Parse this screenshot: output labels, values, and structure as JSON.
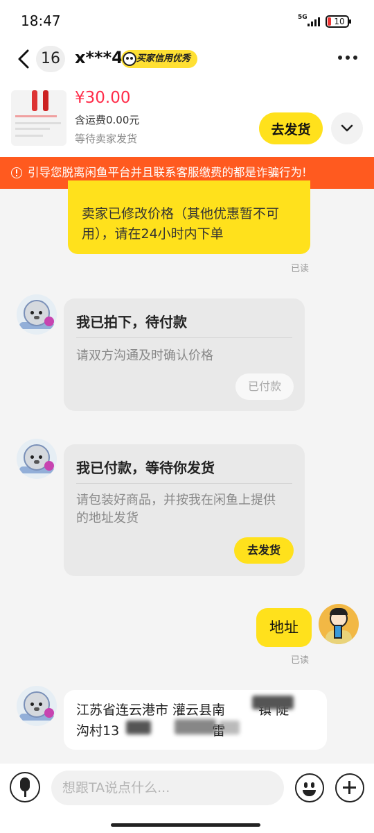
{
  "status_bar": {
    "time": "18:47",
    "network": "5G",
    "battery": "10",
    "icons": [
      "signal-icon",
      "battery-icon"
    ]
  },
  "header": {
    "unread_count": "16",
    "nickname": "x***4",
    "credit_badge": "买家信用优秀",
    "icons": [
      "back-arrow-icon",
      "more-icon"
    ]
  },
  "product": {
    "price": "¥30.00",
    "shipping": "含运费0.00元",
    "status": "等待卖家发货",
    "ship_button": "去发货",
    "icons": [
      "chevron-down-icon"
    ],
    "colors": {
      "price": "#ff2d4a",
      "accent": "#ffe11c"
    }
  },
  "warning": {
    "text": "引导您脱离闲鱼平台并且联系客服缴费的都是诈骗行为!",
    "color": "#ff5a1f",
    "icon": "warning-circle-icon"
  },
  "messages": {
    "price_change": "卖家已修改价格（其他优惠暂不可用），请在24小时内下单",
    "price_change_read": "已读",
    "card1": {
      "title": "我已拍下，待付款",
      "desc": "请双方沟通及时确认价格",
      "button": "已付款"
    },
    "card2": {
      "title": "我已付款，等待你发货",
      "desc": "请包装好商品，并按我在闲鱼上提供的地址发货",
      "button": "去发货"
    },
    "my_message": "地址",
    "my_message_read": "已读",
    "address_line1": "江苏省连云港市 灌云县南",
    "address_line1_tail": "镇 陡",
    "address_line2": "沟村13",
    "address_line2_tail": "雷"
  },
  "input_bar": {
    "placeholder": "想跟TA说点什么...",
    "icons": [
      "microphone-icon",
      "emoji-icon",
      "plus-icon"
    ]
  }
}
